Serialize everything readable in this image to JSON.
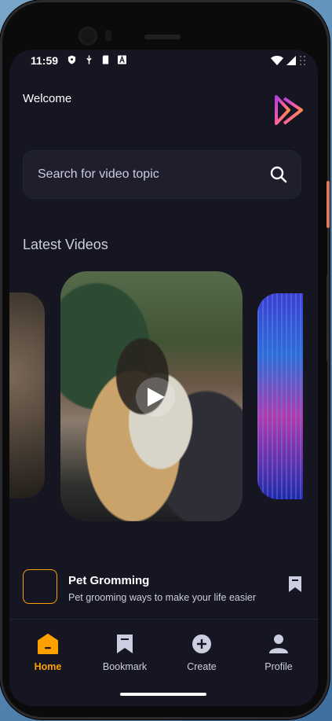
{
  "status_bar": {
    "time": "11:59"
  },
  "header": {
    "welcome": "Welcome"
  },
  "search": {
    "placeholder": "Search for video topic"
  },
  "latest": {
    "title": "Latest Videos"
  },
  "video_item": {
    "title": "Pet Gromming",
    "subtitle": "Pet grooming ways to make your life easier"
  },
  "tabs": [
    {
      "label": "Home",
      "icon": "home-icon",
      "active": true
    },
    {
      "label": "Bookmark",
      "icon": "bookmark-icon",
      "active": false
    },
    {
      "label": "Create",
      "icon": "plus-circle-icon",
      "active": false
    },
    {
      "label": "Profile",
      "icon": "profile-icon",
      "active": false
    }
  ],
  "colors": {
    "background": "#161622",
    "accent": "#FFA001",
    "accent_alt": "#FF9C01",
    "muted_text": "#CDCDE0",
    "input_bg": "#1E1E2D"
  }
}
